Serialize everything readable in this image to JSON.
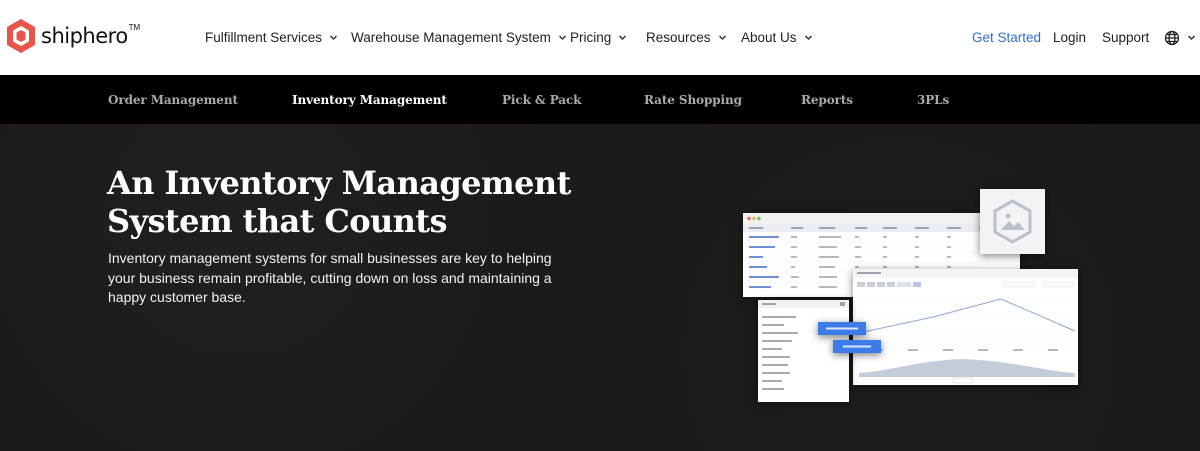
{
  "brand": {
    "name": "shiphero",
    "trademark": "TM"
  },
  "nav": {
    "items": [
      {
        "label": "Fulfillment Services"
      },
      {
        "label": "Warehouse Management System"
      },
      {
        "label": "Pricing"
      },
      {
        "label": "Resources"
      },
      {
        "label": "About Us"
      }
    ],
    "get_started": "Get Started",
    "login": "Login",
    "support": "Support",
    "language_icon": "globe-icon"
  },
  "subnav": {
    "items": [
      {
        "label": "Order Management",
        "active": false
      },
      {
        "label": "Inventory Management",
        "active": true
      },
      {
        "label": "Pick & Pack",
        "active": false
      },
      {
        "label": "Rate Shopping",
        "active": false
      },
      {
        "label": "Reports",
        "active": false
      },
      {
        "label": "3PLs",
        "active": false
      }
    ]
  },
  "hero": {
    "title_line1": "An Inventory Management",
    "title_line2": "System that Counts",
    "description": "Inventory management systems for small businesses are key to helping your business remain profitable, cutting down on loss and maintaining a happy customer base."
  },
  "colors": {
    "accent": "#2f6fd6",
    "brand": "#e8564a",
    "subnav_bg": "#000000",
    "hero_bg": "#1b1817"
  }
}
